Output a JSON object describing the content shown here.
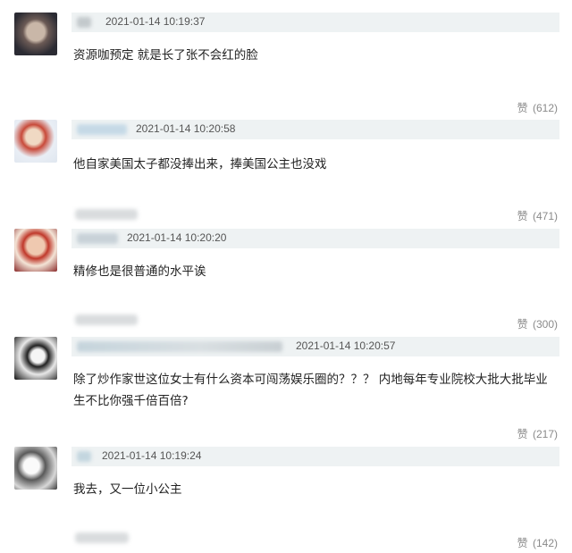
{
  "like_label": "赞",
  "comments": [
    {
      "time": "2021-01-14 10:19:37",
      "text": "资源咖预定 就是长了张不会红的脸",
      "likes": "(612)"
    },
    {
      "time": "2021-01-14 10:20:58",
      "text": "他自家美国太子都没捧出来，捧美国公主也没戏",
      "likes": "(471)"
    },
    {
      "time": "2021-01-14 10:20:20",
      "text": "精修也是很普通的水平诶",
      "likes": "(300)"
    },
    {
      "time": "2021-01-14 10:20:57",
      "text": "除了炒作家世这位女士有什么资本可闯荡娱乐圈的？？？ 内地每年专业院校大批大批毕业生不比你强千倍百倍?",
      "likes": "(217)"
    },
    {
      "time": "2021-01-14 10:19:24",
      "text": "我去，又一位小公主",
      "likes": "(142)"
    }
  ]
}
